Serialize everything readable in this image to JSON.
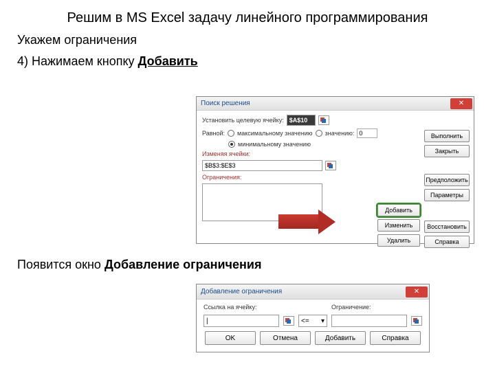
{
  "slide": {
    "title": "Решим в MS Excel задачу линейного программирования",
    "step_intro": "Укажем ограничения",
    "step4": "4) Нажимаем кнопку ",
    "step4_bold": "Добавить",
    "result_text": "Появится окно ",
    "result_bold": "Добавление ограничения"
  },
  "solver": {
    "title": "Поиск решения",
    "target_label": "Установить целевую ячейку:",
    "target_value": "$A$10",
    "equal_label": "Равной:",
    "opt_max": "максимальному значению",
    "opt_val": "значению:",
    "opt_val_num": "0",
    "opt_min": "минимальному значению",
    "changing_label": "Изменяя ячейки:",
    "changing_value": "$B$3:$E$3",
    "constraints_label": "Ограничения:",
    "btn_execute": "Выполнить",
    "btn_close": "Закрыть",
    "btn_guess": "Предположить",
    "btn_params": "Параметры",
    "btn_reset": "Восстановить",
    "btn_help": "Справка",
    "btn_add": "Добавить",
    "btn_change": "Изменить",
    "btn_delete": "Удалить"
  },
  "addcon": {
    "title": "Добавление ограничения",
    "ref_label": "Ссылка на ячейку:",
    "con_label": "Ограничение:",
    "cursor": "|",
    "op": "<=",
    "btn_ok": "OK",
    "btn_cancel": "Отмена",
    "btn_add": "Добавить",
    "btn_help": "Справка"
  }
}
